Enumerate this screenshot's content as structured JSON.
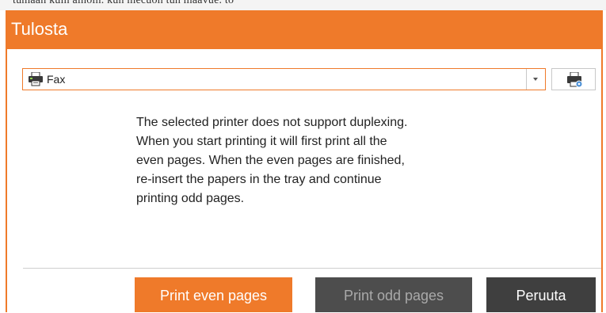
{
  "background": {
    "text": "tumaan kuin ainoin. kun mecuon tun maavue. to"
  },
  "dialog": {
    "title": "Tulosta",
    "accent_color": "#ef7a2a",
    "printer": {
      "selected": "Fax",
      "icon": "printer-icon"
    },
    "properties_button_icon": "printer-settings-icon",
    "message": "The selected printer does not support duplexing.\nWhen you start printing it will first print all the\neven pages. When the even pages are finished,\nre-insert the papers in the tray and continue\nprinting odd pages.",
    "buttons": {
      "print_even": "Print even pages",
      "print_odd": "Print odd pages",
      "cancel": "Peruuta"
    }
  }
}
